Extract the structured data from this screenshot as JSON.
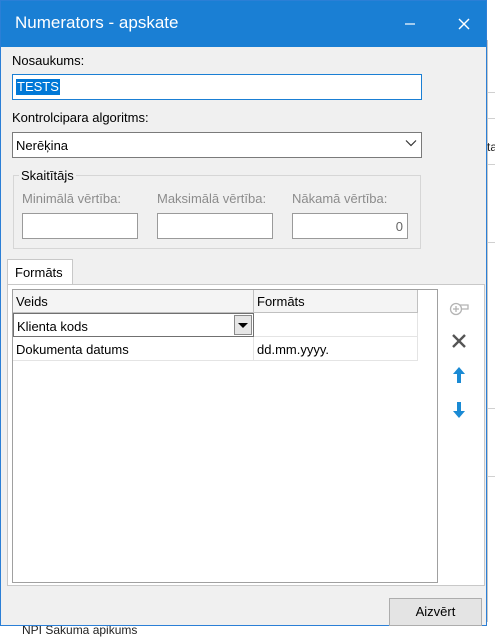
{
  "window": {
    "title": "Numerators - apskate"
  },
  "name_field": {
    "label": "Nosaukums:",
    "value": "TESTS"
  },
  "checkdigit": {
    "label": "Kontrolcipara algoritms:",
    "value": "Nerēķina"
  },
  "counter": {
    "group_label": "Skaitītājs",
    "min_label": "Minimālā vērtība:",
    "min_value": "",
    "max_label": "Maksimālā vērtība:",
    "max_value": "",
    "next_label": "Nākamā vērtība:",
    "next_value": "0"
  },
  "tab": {
    "label": "Formāts"
  },
  "grid": {
    "columns": [
      "Veids",
      "Formāts"
    ],
    "rows": [
      {
        "type": "Klienta kods",
        "format": ""
      },
      {
        "type": "Dokumenta datums",
        "format": "dd.mm.yyyy."
      }
    ]
  },
  "toolbar_icons": [
    "add-icon",
    "delete-icon",
    "move-up-icon",
    "move-down-icon"
  ],
  "close_button": {
    "label": "Aizvērt"
  },
  "background": {
    "right_fragment": "ta",
    "bottom_text": "NPI Sakuma apikums"
  },
  "colors": {
    "titlebar": "#1a7fd4",
    "accent": "#1a8ad4"
  }
}
